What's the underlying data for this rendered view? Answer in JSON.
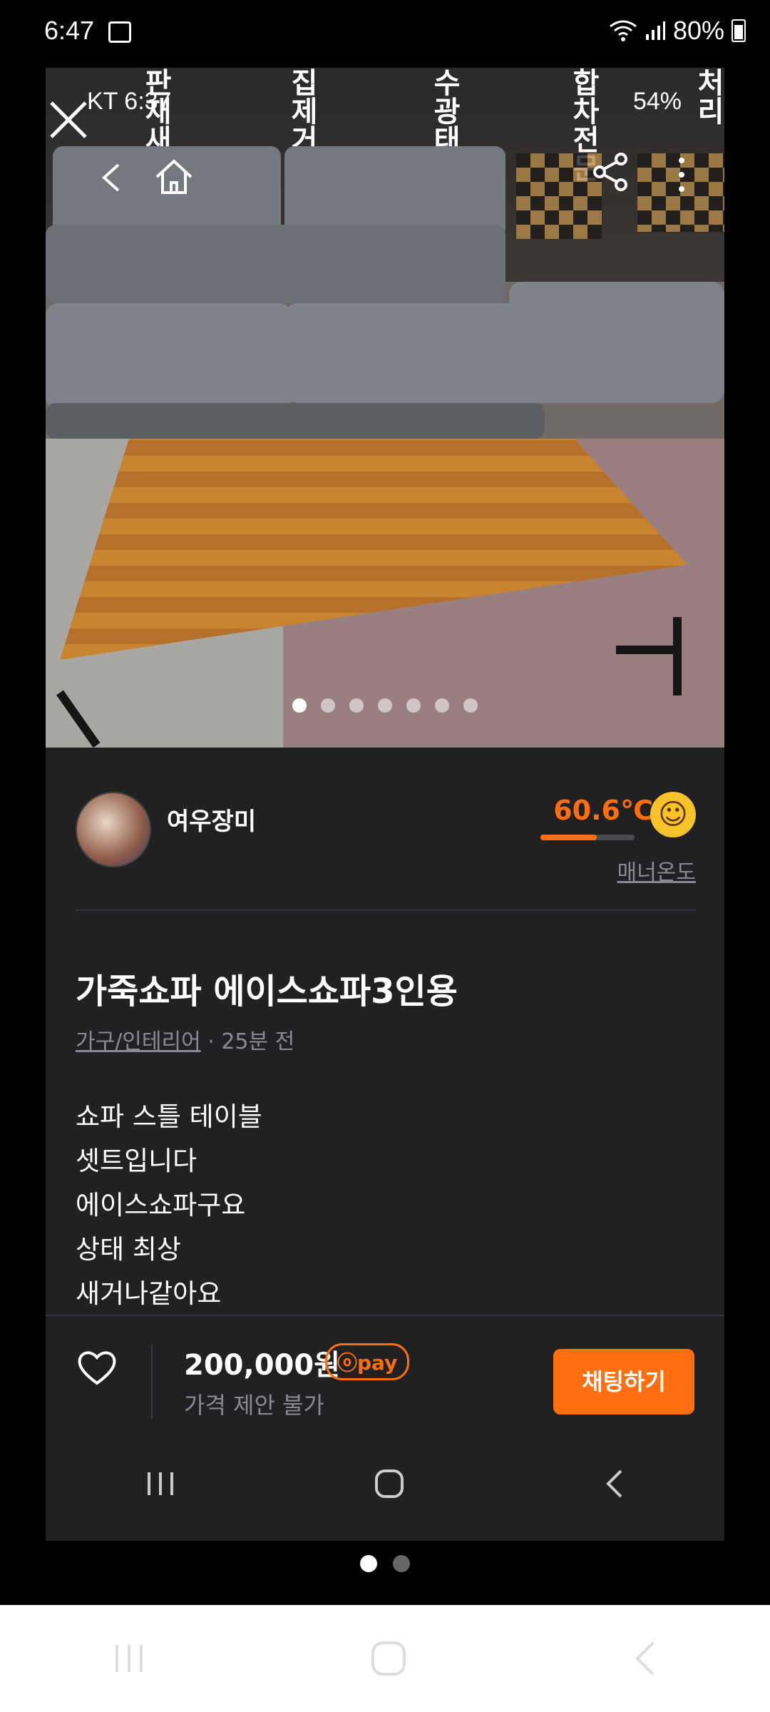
{
  "device_status": {
    "time": "6:47",
    "battery": "80%"
  },
  "photo": {
    "status_left": "KT 6:37",
    "status_right": "54%",
    "signs": [
      "판재새",
      "집제거",
      "수광태",
      "합차전문",
      "처리"
    ],
    "dots_total": 7,
    "dots_active": 0
  },
  "seller": {
    "name": "여우장미",
    "temperature": "60.6℃",
    "temperature_level": 0.6,
    "manner_label": "매너온도"
  },
  "post": {
    "title": "가죽쇼파 에이스쇼파3인용",
    "category": "가구/인테리어",
    "time_ago": "· 25분 전",
    "description": [
      "쇼파 스틀 테이블",
      "셋트입니다",
      "에이스쇼파구요",
      "상태 최상",
      "새거나같아요"
    ]
  },
  "bottom_bar": {
    "price": "200,000원",
    "pay_badge": "pay",
    "negotiation": "가격 제안 불가",
    "chat_button": "채팅하기"
  },
  "icons": [
    "close-icon",
    "back-icon",
    "home-icon",
    "share-icon",
    "more-icon",
    "heart-icon"
  ],
  "colors": {
    "accent": "#ff6f0f",
    "background": "#212124"
  }
}
